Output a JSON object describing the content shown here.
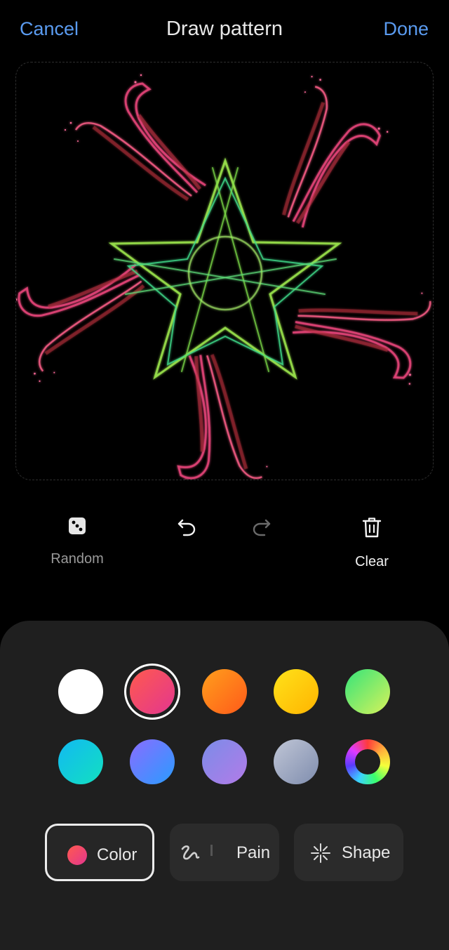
{
  "header": {
    "cancel_label": "Cancel",
    "title": "Draw pattern",
    "done_label": "Done"
  },
  "tools": {
    "random_label": "Random",
    "clear_label": "Clear"
  },
  "palette": {
    "selected_index": 1,
    "swatches": [
      {
        "name": "white",
        "colors": [
          "#ffffff",
          "#ffffff"
        ]
      },
      {
        "name": "pink-red",
        "colors": [
          "#ff5a4e",
          "#e3368f"
        ]
      },
      {
        "name": "orange",
        "colors": [
          "#ff9f1c",
          "#ff5a1a"
        ]
      },
      {
        "name": "yellow",
        "colors": [
          "#ffe21a",
          "#ffb400"
        ]
      },
      {
        "name": "green",
        "colors": [
          "#35e47a",
          "#d8f25a"
        ]
      },
      {
        "name": "cyan",
        "colors": [
          "#12b9f2",
          "#12e0c0"
        ]
      },
      {
        "name": "blue-violet",
        "colors": [
          "#8a6cff",
          "#2a9cff"
        ]
      },
      {
        "name": "lavender",
        "colors": [
          "#7b8ce8",
          "#b27be8"
        ]
      },
      {
        "name": "gray-blue",
        "colors": [
          "#c0c6d6",
          "#7f8dae"
        ]
      },
      {
        "name": "rainbow",
        "colors": [
          "#ff3b3b",
          "#3bff3b"
        ]
      }
    ]
  },
  "modes": {
    "color_label": "Color",
    "paint_label": "Pain",
    "shape_label": "Shape"
  }
}
